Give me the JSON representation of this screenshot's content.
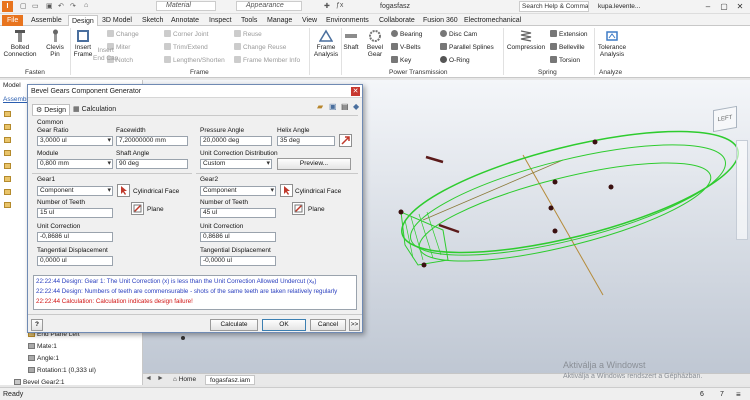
{
  "titlebar": {
    "file_name": "fogasfasz",
    "search_text": "Search Help & Commands...",
    "user": "kupa.levente...",
    "material": "Material",
    "appearance": "Appearance",
    "logo": "I"
  },
  "tabs": [
    "File",
    "Assemble",
    "Design",
    "3D Model",
    "Sketch",
    "Annotate",
    "Inspect",
    "Tools",
    "Manage",
    "View",
    "Environments",
    "Collaborate",
    "Fusion 360",
    "Electromechanical"
  ],
  "ribbon": {
    "bolted": "Bolted\nConnection",
    "clevis": "Clevis\nPin",
    "insert_frame": "Insert\nFrame",
    "frame_analysis": "Frame\nAnalysis",
    "shaft": "Shaft",
    "bevel": "Bevel\nGear",
    "compression": "Compression",
    "tolerance": "Tolerance\nAnalysis",
    "small": {
      "change": "Change",
      "miter": "Miter",
      "notch": "Notch",
      "corner_joint": "Corner Joint",
      "trim_extend": "Trim/Extend",
      "lengthen": "Lengthen/Shorten",
      "reuse": "Reuse",
      "change_reuse": "Change Reuse",
      "frame_member_info": "Frame Member Info",
      "insert_end_cap": "Insert\nEnd Cap",
      "bearing": "Bearing",
      "vbelts": "V-Belts",
      "key": "Key",
      "disc_cam": "Disc Cam",
      "parallel_splines": "Parallel Splines",
      "oring": "O-Ring",
      "extension": "Extension",
      "belleville": "Belleville",
      "torsion": "Torsion"
    },
    "groups": {
      "fasten": "Fasten",
      "frame": "Frame",
      "power": "Power Transmission",
      "spring": "Spring",
      "analyze": "Analyze"
    }
  },
  "left_panel": {
    "model": "Model",
    "assemble": "Assemble",
    "items": [
      "End Plane Left",
      "Mate:1",
      "Angle:1",
      "Rotation:1 (0,333 ul)",
      "Bevel Gear2:1"
    ]
  },
  "dialog": {
    "title": "Bevel Gears Component Generator",
    "tab_design": "Design",
    "tab_calc": "Calculation",
    "common": "Common",
    "gear_ratio_label": "Gear Ratio",
    "gear_ratio": "3,0000 ul",
    "facewidth_label": "Facewidth",
    "facewidth": "7,20000000 mm",
    "pressure_angle_label": "Pressure Angle",
    "pressure_angle": "20,0000 deg",
    "helix_angle_label": "Helix Angle",
    "helix_angle": "35 deg",
    "module_label": "Module",
    "module": "0,800 mm",
    "shaft_angle_label": "Shaft Angle",
    "shaft_angle": "90 deg",
    "ucd_label": "Unit Correction Distribution",
    "ucd": "Custom",
    "preview": "Preview...",
    "gear1": "Gear1",
    "gear2": "Gear2",
    "component": "Component",
    "cyl_face": "Cylindrical Face",
    "plane": "Plane",
    "teeth_label": "Number of Teeth",
    "teeth1": "15 ul",
    "teeth2": "45 ul",
    "uc_label": "Unit Correction",
    "uc1": "-0,8686 ul",
    "uc2": "0,8686 ul",
    "td_label": "Tangential Displacement",
    "td1": "0,0000 ul",
    "td2": "-0,0000 ul",
    "messages": [
      {
        "text": "22:22:44 Design: Gear 1: The Unit Correction (x) is less than the Unit Correction Allowed Undercut (xₐ)",
        "color": "#2a3fbf"
      },
      {
        "text": "22:22:44 Design: Numbers of teeth are commensurable - shots of the same teeth are taken relatively regularly",
        "color": "#2a3fbf"
      },
      {
        "text": "22:22:44 Calculation: Calculation indicates design failure!",
        "color": "#d01515"
      }
    ],
    "calculate": "Calculate",
    "ok": "OK",
    "cancel": "Cancel",
    "more": ">>",
    "help": "?"
  },
  "doc_tabs": {
    "home": "Home",
    "file": "fogasfasz.iam"
  },
  "watermark": {
    "line1": "Aktiválja a Windowst",
    "line2": "Aktiválja a Windows rendszert a Gépházban."
  },
  "status": {
    "ready": "Ready",
    "n1": "6",
    "n2": "7"
  }
}
